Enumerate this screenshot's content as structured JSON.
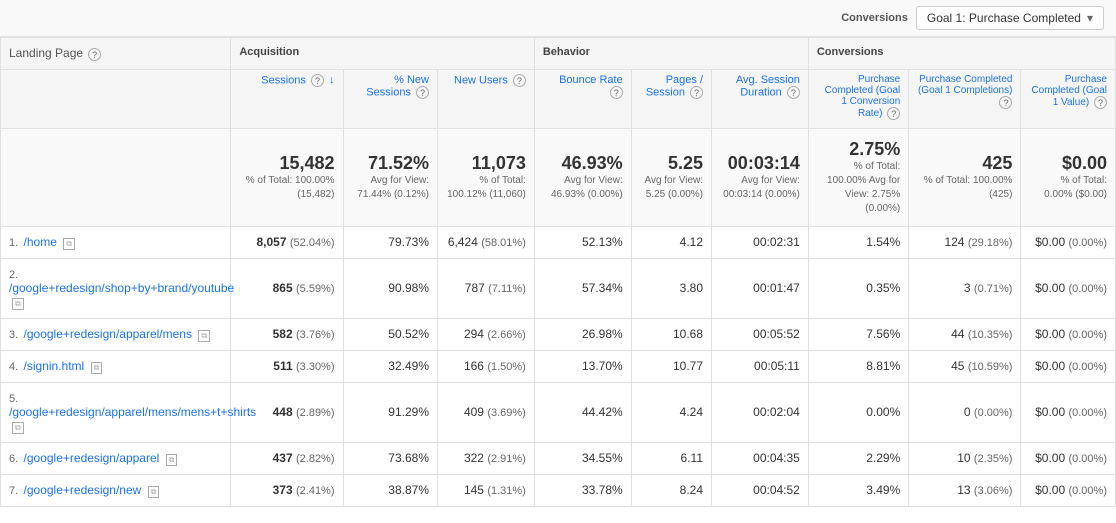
{
  "topBar": {
    "conversionsLabel": "Conversions",
    "goalSelectLabel": "Goal 1: Purchase Completed"
  },
  "columns": {
    "landingPage": "Landing Page",
    "sessions": "Sessions",
    "pctNewSessions": "% New Sessions",
    "newUsers": "New Users",
    "bounceRate": "Bounce Rate",
    "pagesPerSession": "Pages / Session",
    "avgSessionDuration": "Avg. Session Duration",
    "conversionRate": "Purchase Completed (Goal 1 Conversion Rate)",
    "completions": "Purchase Completed (Goal 1 Completions)",
    "goalValue": "Purchase Completed (Goal 1 Value)"
  },
  "groups": {
    "acquisition": "Acquisition",
    "behavior": "Behavior",
    "conversions": "Conversions"
  },
  "totals": {
    "sessions": "15,482",
    "sessionsSub": "% of Total: 100.00% (15,482)",
    "pctNew": "71.52%",
    "pctNewSub": "Avg for View: 71.44% (0.12%)",
    "newUsers": "11,073",
    "newUsersSub": "% of Total: 100.12% (11,060)",
    "bounceRate": "46.93%",
    "bounceRateSub": "Avg for View: 46.93% (0.00%)",
    "pagesPerSession": "5.25",
    "pagesPerSessionSub": "Avg for View: 5.25 (0.00%)",
    "avgSession": "00:03:14",
    "avgSessionSub": "Avg for View: 00:03:14 (0.00%)",
    "convRate": "2.75%",
    "convRateSub": "% of Total: 100.00% Avg for View: 2.75% (0.00%)",
    "completions": "425",
    "completionsSub": "% of Total: 100.00% (425)",
    "goalValue": "$0.00",
    "goalValueSub": "% of Total: 0.00% ($0.00)"
  },
  "rows": [
    {
      "num": "1.",
      "page": "/home",
      "sessions": "8,057",
      "sessionsPct": "(52.04%)",
      "pctNew": "79.73%",
      "newUsers": "6,424",
      "newUsersPct": "(58.01%)",
      "bounceRate": "52.13%",
      "pagesPerSession": "4.12",
      "avgSession": "00:02:31",
      "convRate": "1.54%",
      "completions": "124",
      "completionsPct": "(29.18%)",
      "goalValue": "$0.00",
      "goalValuePct": "(0.00%)"
    },
    {
      "num": "2.",
      "page": "/google+redesign/shop+by+brand/youtube",
      "sessions": "865",
      "sessionsPct": "(5.59%)",
      "pctNew": "90.98%",
      "newUsers": "787",
      "newUsersPct": "(7.11%)",
      "bounceRate": "57.34%",
      "pagesPerSession": "3.80",
      "avgSession": "00:01:47",
      "convRate": "0.35%",
      "completions": "3",
      "completionsPct": "(0.71%)",
      "goalValue": "$0.00",
      "goalValuePct": "(0.00%)"
    },
    {
      "num": "3.",
      "page": "/google+redesign/apparel/mens",
      "sessions": "582",
      "sessionsPct": "(3.76%)",
      "pctNew": "50.52%",
      "newUsers": "294",
      "newUsersPct": "(2.66%)",
      "bounceRate": "26.98%",
      "pagesPerSession": "10.68",
      "avgSession": "00:05:52",
      "convRate": "7.56%",
      "completions": "44",
      "completionsPct": "(10.35%)",
      "goalValue": "$0.00",
      "goalValuePct": "(0.00%)"
    },
    {
      "num": "4.",
      "page": "/signin.html",
      "sessions": "511",
      "sessionsPct": "(3.30%)",
      "pctNew": "32.49%",
      "newUsers": "166",
      "newUsersPct": "(1.50%)",
      "bounceRate": "13.70%",
      "pagesPerSession": "10.77",
      "avgSession": "00:05:11",
      "convRate": "8.81%",
      "completions": "45",
      "completionsPct": "(10.59%)",
      "goalValue": "$0.00",
      "goalValuePct": "(0.00%)"
    },
    {
      "num": "5.",
      "page": "/google+redesign/apparel/mens/mens+t+shirts",
      "sessions": "448",
      "sessionsPct": "(2.89%)",
      "pctNew": "91.29%",
      "newUsers": "409",
      "newUsersPct": "(3.69%)",
      "bounceRate": "44.42%",
      "pagesPerSession": "4.24",
      "avgSession": "00:02:04",
      "convRate": "0.00%",
      "completions": "0",
      "completionsPct": "(0.00%)",
      "goalValue": "$0.00",
      "goalValuePct": "(0.00%)"
    },
    {
      "num": "6.",
      "page": "/google+redesign/apparel",
      "sessions": "437",
      "sessionsPct": "(2.82%)",
      "pctNew": "73.68%",
      "newUsers": "322",
      "newUsersPct": "(2.91%)",
      "bounceRate": "34.55%",
      "pagesPerSession": "6.11",
      "avgSession": "00:04:35",
      "convRate": "2.29%",
      "completions": "10",
      "completionsPct": "(2.35%)",
      "goalValue": "$0.00",
      "goalValuePct": "(0.00%)"
    },
    {
      "num": "7.",
      "page": "/google+redesign/new",
      "sessions": "373",
      "sessionsPct": "(2.41%)",
      "pctNew": "38.87%",
      "newUsers": "145",
      "newUsersPct": "(1.31%)",
      "bounceRate": "33.78%",
      "pagesPerSession": "8.24",
      "avgSession": "00:04:52",
      "convRate": "3.49%",
      "completions": "13",
      "completionsPct": "(3.06%)",
      "goalValue": "$0.00",
      "goalValuePct": "(0.00%)"
    }
  ]
}
